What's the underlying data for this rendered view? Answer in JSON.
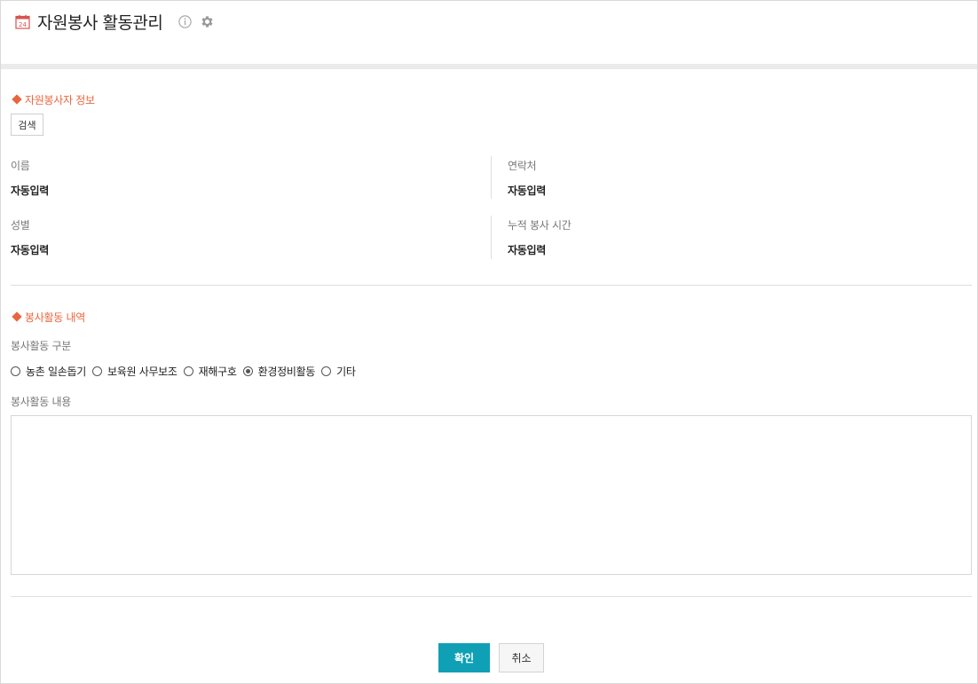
{
  "header": {
    "title": "자원봉사 활동관리",
    "calendar_day": "24",
    "icons": [
      "calendar-icon",
      "info-icon",
      "gear-icon"
    ]
  },
  "volunteer_info": {
    "section_title": "자원봉사자 정보",
    "search_label": "검색",
    "fields": [
      {
        "label": "이름",
        "value": "자동입력"
      },
      {
        "label": "연락처",
        "value": "자동입력"
      },
      {
        "label": "성별",
        "value": "자동입력"
      },
      {
        "label": "누적 봉사 시간",
        "value": "자동입력"
      }
    ]
  },
  "activity": {
    "section_title": "봉사활동 내역",
    "type_label": "봉사활동 구분",
    "options": [
      {
        "label": "농촌 일손돕기",
        "checked": false
      },
      {
        "label": "보육원 사무보조",
        "checked": false
      },
      {
        "label": "재해구호",
        "checked": false
      },
      {
        "label": "환경정비활동",
        "checked": true
      },
      {
        "label": "기타",
        "checked": false
      }
    ],
    "content_label": "봉사활동 내용",
    "content_value": ""
  },
  "footer": {
    "confirm_label": "확인",
    "cancel_label": "취소"
  },
  "colors": {
    "accent": "#e8663d",
    "primary_button": "#0fa0b6",
    "divider": "#dedede"
  }
}
